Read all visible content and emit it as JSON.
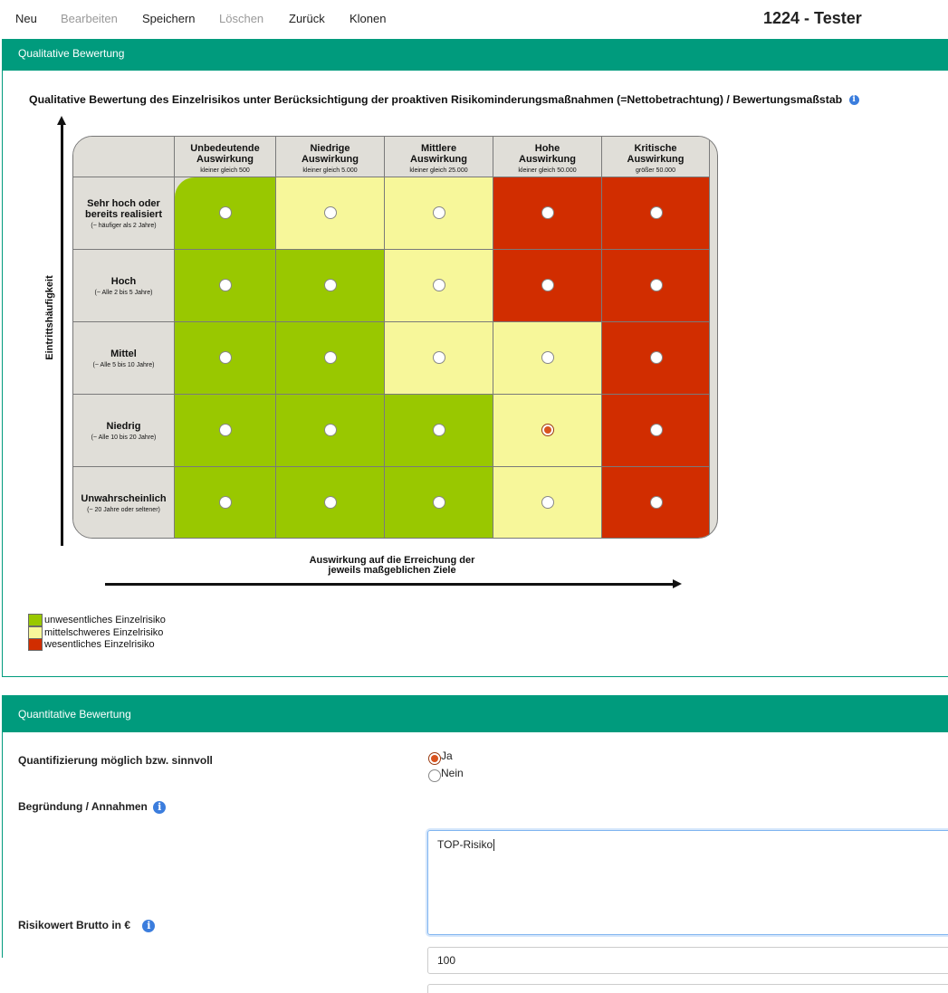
{
  "toolbar": {
    "items": [
      {
        "label": "Neu",
        "enabled": true
      },
      {
        "label": "Bearbeiten",
        "enabled": false
      },
      {
        "label": "Speichern",
        "enabled": true
      },
      {
        "label": "Löschen",
        "enabled": false
      },
      {
        "label": "Zurück",
        "enabled": true
      },
      {
        "label": "Klonen",
        "enabled": true
      }
    ],
    "title": "1224 - Tester"
  },
  "qualitative": {
    "panel_title": "Qualitative Bewertung",
    "heading": "Qualitative Bewertung des Einzelrisikos unter Berücksichtigung der proaktiven Risikominderungsmaßnahmen (=Nettobetrachtung) / Bewertungsmaßstab",
    "y_axis_label": "Eintrittshäufigkeit",
    "x_axis_label_line1": "Auswirkung auf die Erreichung der",
    "x_axis_label_line2": "jeweils maßgeblichen Ziele",
    "columns": [
      {
        "title_l1": "Unbedeutende",
        "title_l2": "Auswirkung",
        "sub": "kleiner gleich 500"
      },
      {
        "title_l1": "Niedrige",
        "title_l2": "Auswirkung",
        "sub": "kleiner gleich 5.000"
      },
      {
        "title_l1": "Mittlere",
        "title_l2": "Auswirkung",
        "sub": "kleiner gleich 25.000"
      },
      {
        "title_l1": "Hohe",
        "title_l2": "Auswirkung",
        "sub": "kleiner gleich 50.000"
      },
      {
        "title_l1": "Kritische",
        "title_l2": "Auswirkung",
        "sub": "größer 50.000"
      }
    ],
    "rows": [
      {
        "title_l1": "Sehr hoch oder",
        "title_l2": "bereits realisiert",
        "sub": "(~ häufiger als 2 Jahre)"
      },
      {
        "title_l1": "Hoch",
        "title_l2": "",
        "sub": "(~ Alle 2 bis 5 Jahre)"
      },
      {
        "title_l1": "Mittel",
        "title_l2": "",
        "sub": "(~ Alle 5 bis 10 Jahre)"
      },
      {
        "title_l1": "Niedrig",
        "title_l2": "",
        "sub": "(~ Alle 10 bis 20 Jahre)"
      },
      {
        "title_l1": "Unwahrscheinlich",
        "title_l2": "",
        "sub": "(~ 20 Jahre oder seltener)"
      }
    ],
    "cell_levels": [
      [
        "green",
        "yellow",
        "yellow",
        "red",
        "red"
      ],
      [
        "green",
        "green",
        "yellow",
        "red",
        "red"
      ],
      [
        "green",
        "green",
        "yellow",
        "yellow",
        "red"
      ],
      [
        "green",
        "green",
        "green",
        "yellow",
        "red"
      ],
      [
        "green",
        "green",
        "green",
        "yellow",
        "red"
      ]
    ],
    "selected_cell": {
      "row": 3,
      "col": 3
    },
    "colors": {
      "green": "#99c800",
      "yellow": "#f7f79a",
      "red": "#d12d00"
    },
    "legend": [
      {
        "color": "green",
        "label": "unwesentliches Einzelrisiko"
      },
      {
        "color": "yellow",
        "label": "mittelschweres Einzelrisiko"
      },
      {
        "color": "red",
        "label": "wesentliches Einzelrisiko"
      }
    ]
  },
  "quantitative": {
    "panel_title": "Quantitative Bewertung",
    "quantification_label": "Quantifizierung möglich bzw. sinnvoll",
    "options": [
      {
        "label": "Ja",
        "selected": true
      },
      {
        "label": "Nein",
        "selected": false
      }
    ],
    "reason_label": "Begründung / Annahmen",
    "reason_value": "TOP-Risiko",
    "gross_label": "Risikowert Brutto in €",
    "gross_value": "100"
  },
  "accent_color": "#009b7d"
}
